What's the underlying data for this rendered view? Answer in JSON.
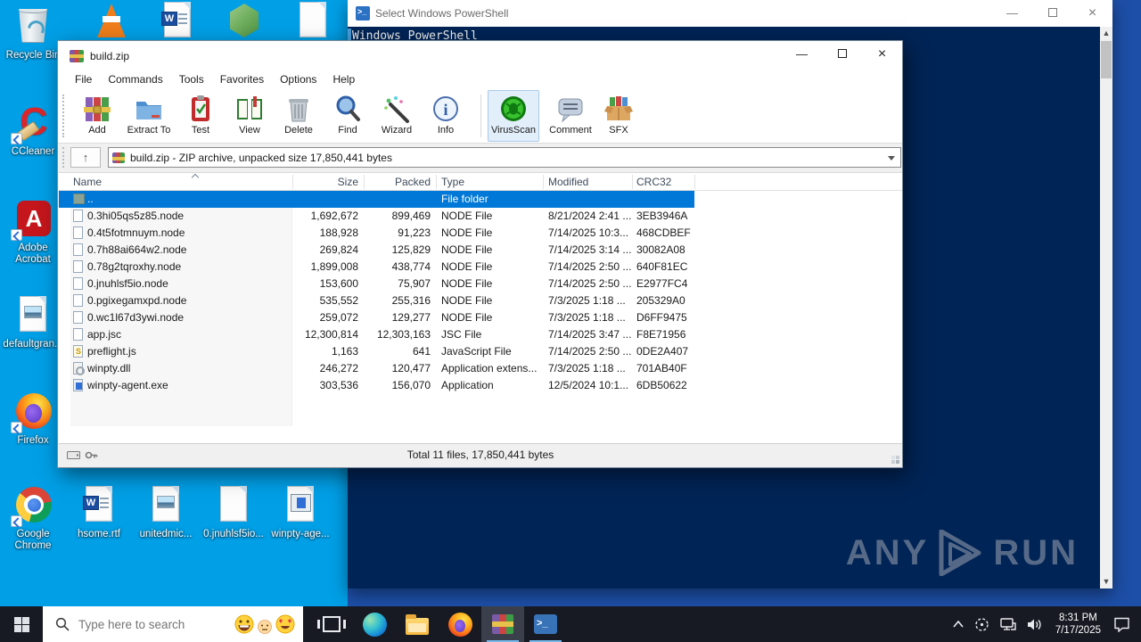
{
  "colors": {
    "desktop_left": "#009fe6",
    "desktop_right": "#1d4fa8",
    "powershell_bg": "#012456",
    "selection_blue": "#0078d7",
    "taskbar_bg": "#171a22",
    "taskbar_underline": "#76b9ed"
  },
  "desktop": {
    "icons_left": [
      {
        "icon": "recycle-bin-icon",
        "label": "Recycle Bin"
      },
      {
        "icon": "ccleaner-icon",
        "label": "CCleaner"
      },
      {
        "icon": "adobe-acrobat-icon",
        "label": "Adobe Acrobat"
      },
      {
        "icon": "image-file-icon",
        "label": "defaultgran..."
      },
      {
        "icon": "firefox-icon",
        "label": "Firefox"
      }
    ],
    "icons_bottom": [
      {
        "icon": "google-chrome-icon",
        "label": "Google Chrome"
      },
      {
        "icon": "word-doc-icon",
        "label": "hsome.rtf"
      },
      {
        "icon": "image-file-icon",
        "label": "unitedmic..."
      },
      {
        "icon": "blank-file-icon",
        "label": "0.jnuhlsf5io..."
      },
      {
        "icon": "exe-file-icon",
        "label": "winpty-age..."
      }
    ],
    "icons_top": [
      {
        "icon": "vlc-icon"
      },
      {
        "icon": "word-doc-icon"
      },
      {
        "icon": "node-green-icon"
      },
      {
        "icon": "blank-file-icon"
      }
    ]
  },
  "powershell": {
    "title": "Select Windows PowerShell",
    "content_line": "Windows PowerShell"
  },
  "watermark": {
    "left": "ANY",
    "right": "RUN"
  },
  "winrar": {
    "title": "build.zip",
    "menu": [
      "File",
      "Commands",
      "Tools",
      "Favorites",
      "Options",
      "Help"
    ],
    "toolbar": [
      "Add",
      "Extract To",
      "Test",
      "View",
      "Delete",
      "Find",
      "Wizard",
      "Info",
      "VirusScan",
      "Comment",
      "SFX"
    ],
    "address": "build.zip - ZIP archive, unpacked size 17,850,441 bytes",
    "columns": [
      "Name",
      "Size",
      "Packed",
      "Type",
      "Modified",
      "CRC32"
    ],
    "rows": [
      {
        "name": "..",
        "size": "",
        "packed": "",
        "type": "File folder",
        "modified": "",
        "crc32": "",
        "icon": "folder-icon",
        "selected": true
      },
      {
        "name": "0.3hi05qs5z85.node",
        "size": "1,692,672",
        "packed": "899,469",
        "type": "NODE File",
        "modified": "8/21/2024 2:41 ...",
        "crc32": "3EB3946A",
        "icon": "file-icon",
        "selected": false
      },
      {
        "name": "0.4t5fotmnuym.node",
        "size": "188,928",
        "packed": "91,223",
        "type": "NODE File",
        "modified": "7/14/2025 10:3...",
        "crc32": "468CDBEF",
        "icon": "file-icon",
        "selected": false
      },
      {
        "name": "0.7h88ai664w2.node",
        "size": "269,824",
        "packed": "125,829",
        "type": "NODE File",
        "modified": "7/14/2025 3:14 ...",
        "crc32": "30082A08",
        "icon": "file-icon",
        "selected": false
      },
      {
        "name": "0.78g2tqroxhy.node",
        "size": "1,899,008",
        "packed": "438,774",
        "type": "NODE File",
        "modified": "7/14/2025 2:50 ...",
        "crc32": "640F81EC",
        "icon": "file-icon",
        "selected": false
      },
      {
        "name": "0.jnuhlsf5io.node",
        "size": "153,600",
        "packed": "75,907",
        "type": "NODE File",
        "modified": "7/14/2025 2:50 ...",
        "crc32": "E2977FC4",
        "icon": "file-icon",
        "selected": false
      },
      {
        "name": "0.pgixegamxpd.node",
        "size": "535,552",
        "packed": "255,316",
        "type": "NODE File",
        "modified": "7/3/2025 1:18 ...",
        "crc32": "205329A0",
        "icon": "file-icon",
        "selected": false
      },
      {
        "name": "0.wc1l67d3ywi.node",
        "size": "259,072",
        "packed": "129,277",
        "type": "NODE File",
        "modified": "7/3/2025 1:18 ...",
        "crc32": "D6FF9475",
        "icon": "file-icon",
        "selected": false
      },
      {
        "name": "app.jsc",
        "size": "12,300,814",
        "packed": "12,303,163",
        "type": "JSC File",
        "modified": "7/14/2025 3:47 ...",
        "crc32": "F8E71956",
        "icon": "file-icon",
        "selected": false
      },
      {
        "name": "preflight.js",
        "size": "1,163",
        "packed": "641",
        "type": "JavaScript File",
        "modified": "7/14/2025 2:50 ...",
        "crc32": "0DE2A407",
        "icon": "js-file-icon",
        "selected": false
      },
      {
        "name": "winpty.dll",
        "size": "246,272",
        "packed": "120,477",
        "type": "Application extens...",
        "modified": "7/3/2025 1:18 ...",
        "crc32": "701AB40F",
        "icon": "dll-file-icon",
        "selected": false
      },
      {
        "name": "winpty-agent.exe",
        "size": "303,536",
        "packed": "156,070",
        "type": "Application",
        "modified": "12/5/2024 10:1...",
        "crc32": "6DB50622",
        "icon": "exe-file-icon",
        "selected": false
      }
    ],
    "status_total": "Total 11 files, 17,850,441 bytes"
  },
  "taskbar": {
    "search_placeholder": "Type here to search",
    "time": "8:31 PM",
    "date": "7/17/2025"
  }
}
